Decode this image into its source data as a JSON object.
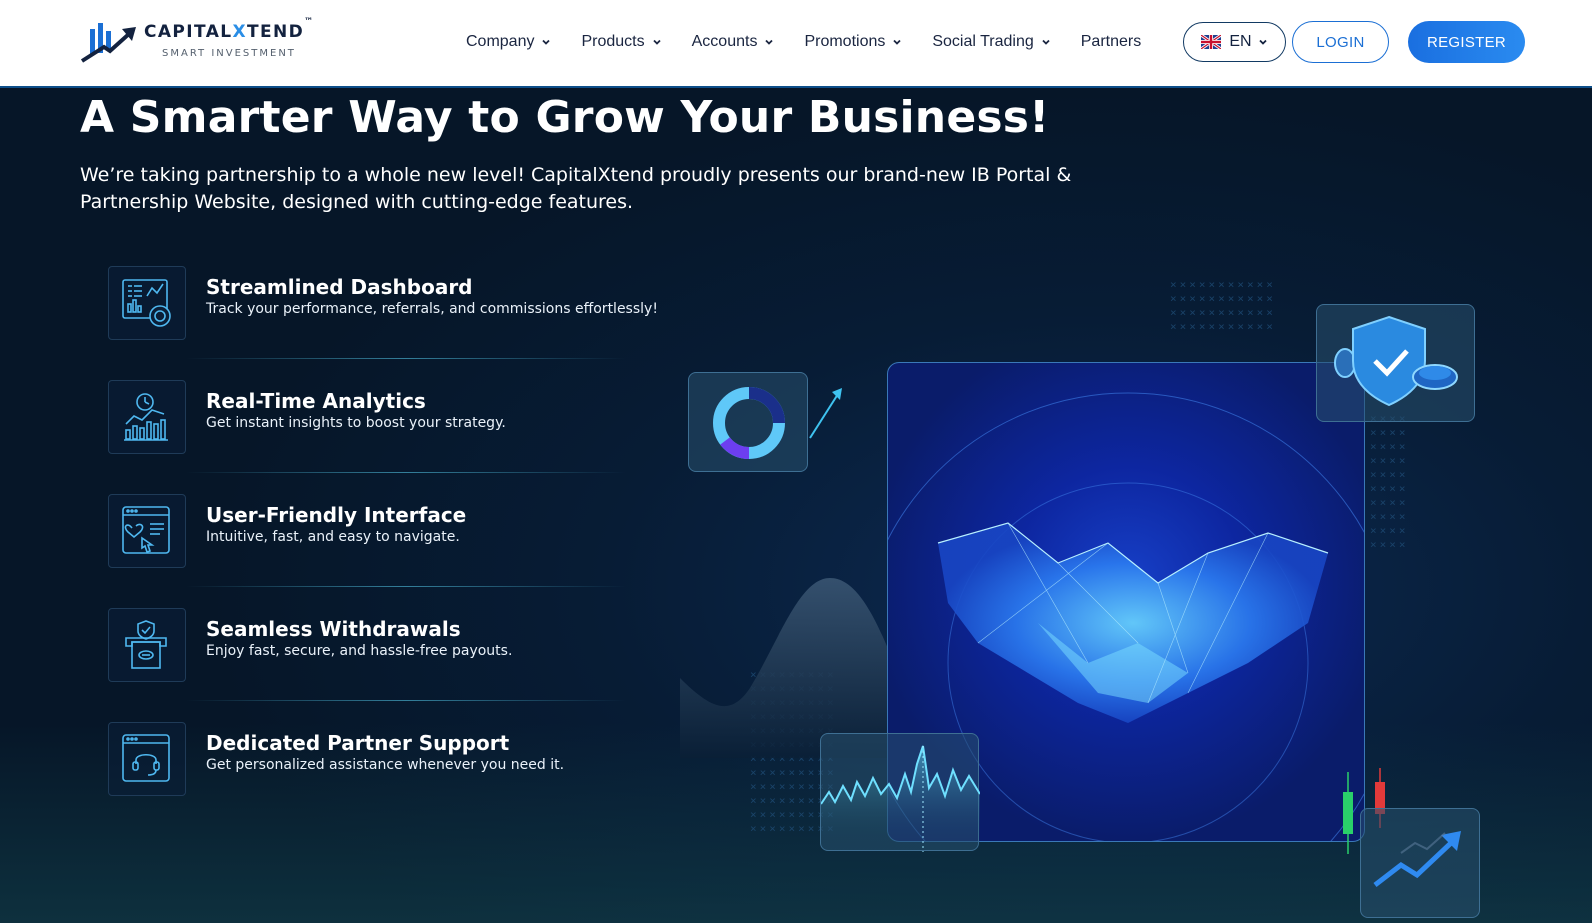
{
  "brand": {
    "name_part1": "CAPITAL",
    "name_x": "X",
    "name_part2": "TEND",
    "trademark": "™",
    "tagline": "SMART INVESTMENT"
  },
  "nav": {
    "items": [
      {
        "label": "Company",
        "dropdown": true
      },
      {
        "label": "Products",
        "dropdown": true
      },
      {
        "label": "Accounts",
        "dropdown": true
      },
      {
        "label": "Promotions",
        "dropdown": true
      },
      {
        "label": "Social Trading",
        "dropdown": true
      },
      {
        "label": "Partners",
        "dropdown": false
      }
    ],
    "language": "EN",
    "login_label": "LOGIN",
    "register_label": "REGISTER"
  },
  "hero": {
    "title": "A Smarter Way to Grow Your Business!",
    "subtitle": "We’re taking partnership to a whole new level! CapitalXtend proudly presents our brand-new IB Portal & Partnership Website, designed with cutting-edge features."
  },
  "features": [
    {
      "icon": "dashboard-icon",
      "title": "Streamlined Dashboard",
      "desc": "Track your performance, referrals, and commissions effortlessly!"
    },
    {
      "icon": "analytics-icon",
      "title": "Real-Time Analytics",
      "desc": "Get instant insights to boost your strategy."
    },
    {
      "icon": "interface-icon",
      "title": "User-Friendly Interface",
      "desc": "Intuitive, fast, and easy to navigate."
    },
    {
      "icon": "withdrawal-icon",
      "title": "Seamless Withdrawals",
      "desc": "Enjoy fast, secure, and hassle-free payouts."
    },
    {
      "icon": "support-icon",
      "title": "Dedicated Partner Support",
      "desc": "Get personalized assistance whenever you need it."
    }
  ],
  "colors": {
    "brand_blue": "#1b6fd4",
    "hero_bg": "#071a30",
    "accent_cyan": "#3fc3f0"
  }
}
